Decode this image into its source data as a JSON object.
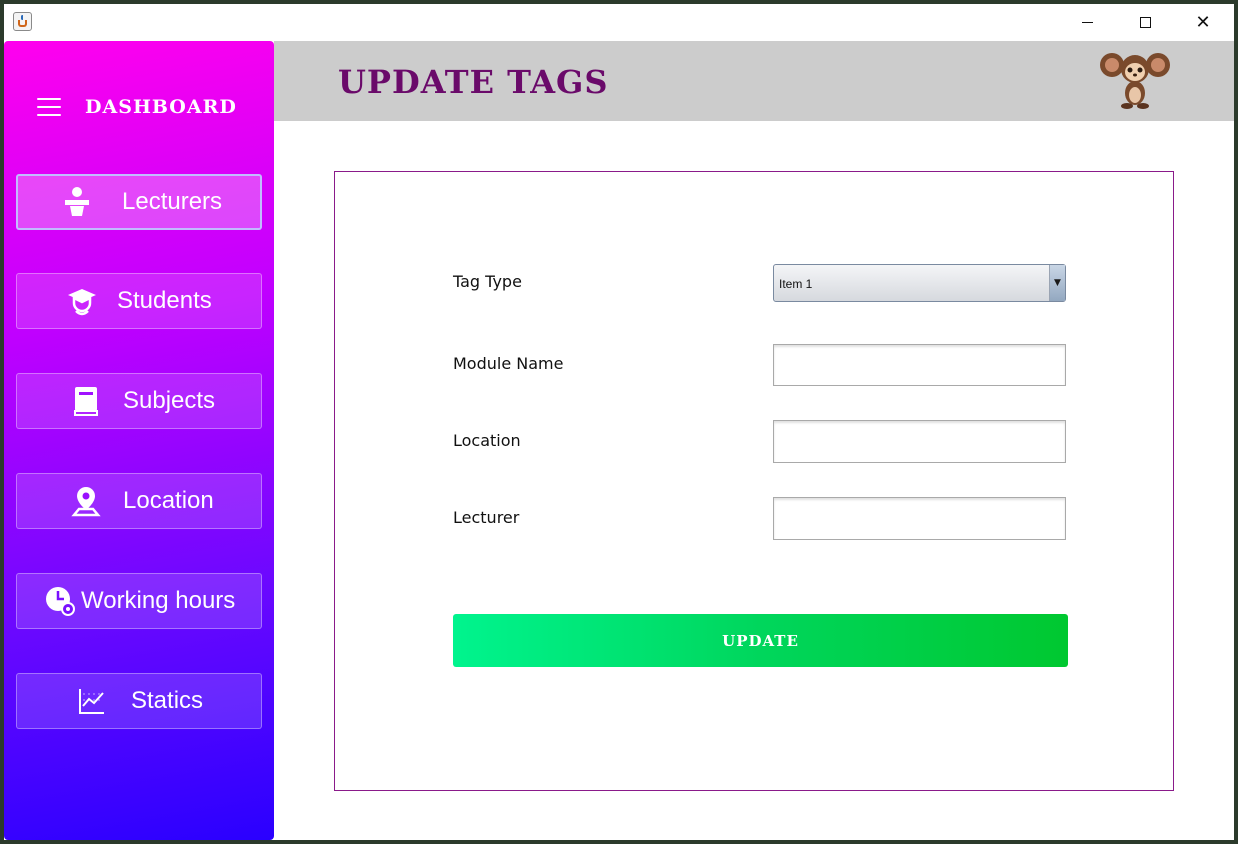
{
  "window": {
    "controls": {
      "minimize_icon": "minimize-icon",
      "maximize_icon": "maximize-icon",
      "close_icon": "close-icon",
      "close_glyph": "✕"
    }
  },
  "sidebar": {
    "title": "DASHBOARD",
    "items": [
      {
        "label": "Lecturers",
        "icon": "lecturer-icon",
        "active": true
      },
      {
        "label": "Students",
        "icon": "graduate-icon",
        "active": false
      },
      {
        "label": "Subjects",
        "icon": "book-icon",
        "active": false
      },
      {
        "label": "Location",
        "icon": "location-pin-icon",
        "active": false
      },
      {
        "label": "Working hours",
        "icon": "clock-gear-icon",
        "active": false
      },
      {
        "label": "Statics",
        "icon": "line-chart-icon",
        "active": false
      }
    ]
  },
  "header": {
    "title": "UPDATE TAGS",
    "mascot": "cheburashka-mascot"
  },
  "form": {
    "tag_type": {
      "label": "Tag Type",
      "value": "Item 1"
    },
    "module_name": {
      "label": "Module Name",
      "value": ""
    },
    "location": {
      "label": "Location",
      "value": ""
    },
    "lecturer": {
      "label": "Lecturer",
      "value": ""
    },
    "submit_label": "UPDATE"
  },
  "colors": {
    "sidebar_top": "#ff00ee",
    "sidebar_bottom": "#2a00ff",
    "title_color": "#6a0a6a",
    "form_border": "#8a1a8a",
    "button_start": "#00f48e",
    "button_end": "#00c830"
  }
}
